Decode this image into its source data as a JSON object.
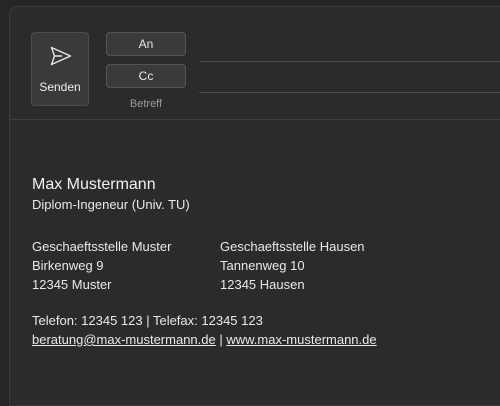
{
  "header": {
    "send_label": "Senden",
    "to_label": "An",
    "cc_label": "Cc",
    "subject_label": "Betreff"
  },
  "signature": {
    "name": "Max Mustermann",
    "title": "Diplom-Ingeneur (Univ. TU)",
    "office1": {
      "name": "Geschaeftsstelle Muster",
      "street": "Birkenweg 9",
      "city": "12345 Muster"
    },
    "office2": {
      "name": "Geschaeftsstelle Hausen",
      "street": "Tannenweg 10",
      "city": "12345 Hausen"
    },
    "phone_line": "Telefon: 12345 123 | Telefax: 12345 123",
    "email": "beratung@max-mustermann.de",
    "separator": " | ",
    "website": "www.max-mustermann.de"
  },
  "colors": {
    "background": "#262626",
    "window": "#2b2b2b",
    "button": "#3a3a3a",
    "text": "#eaeaea"
  },
  "icons": {
    "send": "send-icon"
  }
}
